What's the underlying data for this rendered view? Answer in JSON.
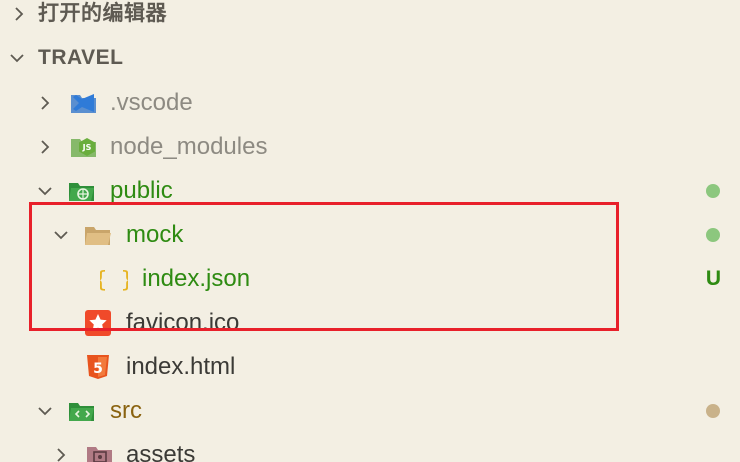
{
  "open_editors": {
    "label": "打开的编辑器"
  },
  "project": {
    "label": "TRAVEL"
  },
  "tree": {
    "vscode": {
      "label": ".vscode",
      "icon": "vscode-folder-icon"
    },
    "node_modules": {
      "label": "node_modules",
      "icon": "nodejs-folder-icon"
    },
    "public": {
      "label": "public",
      "icon": "public-folder-icon",
      "status": "modified-dot"
    },
    "mock": {
      "label": "mock",
      "icon": "folder-open-icon",
      "status": "modified-dot"
    },
    "index_json": {
      "label": "index.json",
      "icon": "json-braces-icon",
      "status": "U"
    },
    "favicon": {
      "label": "favicon.ico",
      "icon": "favicon-star-icon"
    },
    "index_html": {
      "label": "index.html",
      "icon": "html5-icon"
    },
    "src": {
      "label": "src",
      "icon": "src-folder-icon",
      "status": "modified-dot"
    },
    "assets": {
      "label": "assets",
      "icon": "assets-folder-icon"
    }
  },
  "colors": {
    "background": "#f3efe3",
    "untracked_green": "#2e8b12",
    "modified_olive": "#8a6310",
    "dot_green": "#8cc77e",
    "dot_tan": "#c9b28a",
    "highlight_red": "#e8202a"
  }
}
